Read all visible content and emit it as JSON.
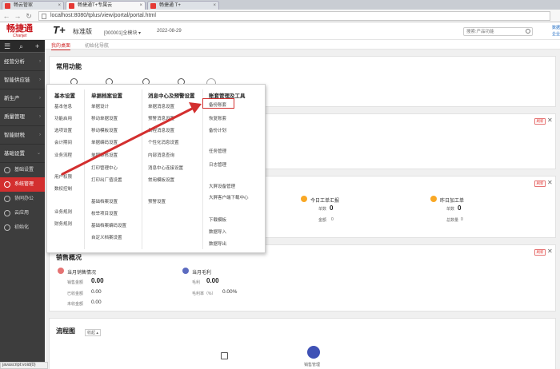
{
  "browser": {
    "tabs": [
      {
        "label": "畅云管家",
        "color": "#e53935",
        "active": false
      },
      {
        "label": "畅捷通T+专属云",
        "color": "#e53935",
        "active": true
      },
      {
        "label": "畅捷通 T+",
        "color": "#e53935",
        "active": false
      }
    ],
    "url": "localhost:8080/tplus/view/portal/portal.html"
  },
  "header": {
    "logo": "畅捷通",
    "logo_sub": "Chanjet",
    "product": "T+",
    "product_edition": "标准版",
    "account": "[000001]全模块 ▾",
    "date": "2022-08-29",
    "search_placeholder": "搜索:产品功能",
    "link_top": "数据",
    "link_bottom": "企业"
  },
  "sidebar": {
    "tools": [
      "☰",
      "⌕",
      "+"
    ],
    "items": [
      {
        "label": "经营分析",
        "arrow": "›"
      },
      {
        "label": "智能供应链",
        "arrow": "›"
      },
      {
        "label": "新生产",
        "arrow": "›"
      },
      {
        "label": "质量管理",
        "arrow": "›"
      },
      {
        "label": "智能财税",
        "arrow": "›"
      },
      {
        "label": "基础设置",
        "arrow": "⌄"
      }
    ],
    "subitems": [
      {
        "label": "基础设置",
        "active": false
      },
      {
        "label": "系统管理",
        "active": true
      },
      {
        "label": "协同办公",
        "active": false
      },
      {
        "label": "云应用",
        "active": false
      },
      {
        "label": "初始化",
        "active": false
      }
    ]
  },
  "page_tabs": [
    {
      "label": "我的桌面",
      "active": true
    },
    {
      "label": "初始化导航",
      "active": false
    }
  ],
  "panels": {
    "common_title": "常用功能",
    "refresh_label": "刷新",
    "close_label": "✕",
    "stats": [
      {
        "label": "今日工单汇报",
        "count_label": "单数",
        "count": "0",
        "sub_label": "金额",
        "sub": "0",
        "color": "#f9a825"
      },
      {
        "label": "昨日加工单",
        "count_label": "单数",
        "count": "0",
        "sub_label": "总数量",
        "sub": "0",
        "color": "#f9a825"
      }
    ],
    "sales_title": "销售概况",
    "sales": [
      {
        "title": "当月销售情况",
        "color": "#e57373",
        "rows": [
          {
            "label": "销售金额",
            "value": "0.00"
          },
          {
            "label": "已收金额",
            "value": "0.00"
          },
          {
            "label": "未收金额",
            "value": "0.00"
          }
        ]
      },
      {
        "title": "当月毛利",
        "color": "#5c6bc0",
        "rows": [
          {
            "label": "毛利",
            "value": "0.00"
          },
          {
            "label": "毛利率（%）",
            "value": "0.00%"
          }
        ]
      }
    ],
    "flow_title": "流程图",
    "flow_collapse": "收起 ▴",
    "flow_node": "销售管理"
  },
  "mega_menu": {
    "col1": {
      "head": "基本设置",
      "items": [
        "基本信息",
        "功能启用",
        "选项设置",
        "会计期间",
        "业务流程",
        "用户权限",
        "数权控制",
        "业务规则",
        "财务规则"
      ]
    },
    "col2": {
      "head": "单据档案设置",
      "items": [
        "单据设计",
        "移动单据设置",
        "移动模板设置",
        "单据编码设置",
        "单据审核设置",
        "打印管理中心",
        "打印出厂值设置",
        "基础档案设置",
        "枚举项目设置",
        "基础档案编码设置",
        "自定义档案设置"
      ]
    },
    "col3": {
      "head": "消息中心及预警设置",
      "items": [
        "单据消息设置",
        "预警消息设置",
        "日程消息设置",
        "个性化消息设置",
        "内部消息查询",
        "消息中心连接设置",
        "常用模板设置",
        "预警设置"
      ]
    },
    "col4": {
      "head": "账套管理及工具",
      "items": [
        "备份账套",
        "恢复账套",
        "备份计划",
        "任务管理",
        "日志管理",
        "大屏设备管理",
        "大屏客户端下载中心",
        "下载模板",
        "数据导入",
        "数据导出"
      ]
    }
  },
  "status_text": "javascript:void(0)"
}
